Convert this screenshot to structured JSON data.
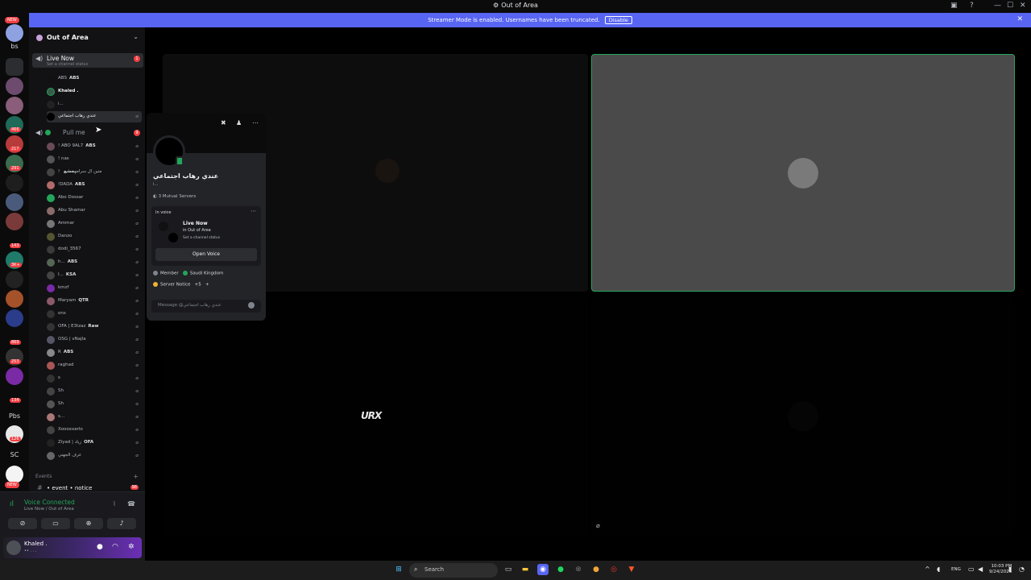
{
  "window": {
    "title": "Out of Area",
    "controls": [
      "—",
      "☐",
      "✕"
    ]
  },
  "banner": {
    "text": "Streamer Mode is enabled. Usernames have been truncated.",
    "button": "Disable"
  },
  "rail": {
    "new_badge_top": "NEW",
    "text_servers": [
      "bs",
      "Pbs",
      "SC"
    ],
    "badges": [
      "466",
      "217",
      "291",
      "143",
      "3K+",
      "869",
      "253",
      "134",
      "126"
    ],
    "new_badge_bottom": "NEW"
  },
  "sidebar": {
    "server_name": "Out of Area",
    "voice_channel": {
      "name": "Live Now",
      "status": "Set a channel status",
      "count": "1"
    },
    "live_users": [
      {
        "name": "ABS",
        "tag": "ABS"
      },
      {
        "name": "Khaled .",
        "tag": ""
      },
      {
        "name": "i...",
        "tag": ""
      },
      {
        "name": "عندي رهاب اجتماعي",
        "tag": ""
      }
    ],
    "second_channel": {
      "name": "Pull me",
      "count": "9"
    },
    "pull_users": [
      {
        "name": "! ABO 9AL7",
        "tag": "ABS"
      },
      {
        "name": "! nas",
        "tag": ""
      },
      {
        "name": "! متين ال سرامه",
        "tag": "جشع"
      },
      {
        "name": "!DADA",
        "tag": "ABS"
      },
      {
        "name": "Abo Dossar",
        "tag": ""
      },
      {
        "name": "Abu Shamar",
        "tag": ""
      },
      {
        "name": "Ammar",
        "tag": ""
      },
      {
        "name": "Danzo",
        "tag": ""
      },
      {
        "name": "dodi_3567",
        "tag": ""
      },
      {
        "name": "h...",
        "tag": "ABS"
      },
      {
        "name": "I...",
        "tag": "KSA"
      },
      {
        "name": "kmzf",
        "tag": ""
      },
      {
        "name": "Maryam",
        "tag": "QTR"
      },
      {
        "name": "ons",
        "tag": ""
      },
      {
        "name": "OFA | E3tzaz",
        "tag": "Raw"
      },
      {
        "name": "OSG | vNajla",
        "tag": ""
      },
      {
        "name": "R",
        "tag": "ABS"
      },
      {
        "name": "raghad",
        "tag": ""
      },
      {
        "name": "s",
        "tag": ""
      },
      {
        "name": "Sh",
        "tag": ""
      },
      {
        "name": "Sh",
        "tag": ""
      },
      {
        "name": "s...",
        "tag": ""
      },
      {
        "name": "Xoooxxarlo",
        "tag": ""
      },
      {
        "name": "Ziyad | زياد",
        "tag": "OFA"
      },
      {
        "name": "عرف الجهني",
        "tag": ""
      }
    ],
    "events_label": "Events",
    "notice_channel": "• event • notice",
    "notice_count": "98"
  },
  "voice_panel": {
    "status": "Voice Connected",
    "location": "Live Now / Out of Area"
  },
  "user_panel": {
    "name": "Khaled .",
    "status": "•• . . ."
  },
  "popout": {
    "display_name": "عندي رهاب اجتماعي",
    "username": "i...",
    "mutual": "3 Mutual Servers",
    "in_voice_label": "In voice",
    "voice_name": "Live Now",
    "voice_in": "in Out of Area",
    "voice_status": "Set a channel status",
    "open_voice": "Open Voice",
    "role_member": "Member",
    "role_country": "Saudi Kingdom",
    "role_server_notice": "Server Notice",
    "role_more": "+5",
    "message_placeholder": "Message @عندي رهاب اجتماعي"
  },
  "stage": {
    "logo_text": "URX"
  },
  "taskbar": {
    "search": "Search",
    "lang": "ENG",
    "time": "10:03 PM",
    "date": "9/24/2025"
  },
  "colors": {
    "accent": "#5865f2",
    "voice_green": "#23a55a",
    "danger": "#f23f43"
  }
}
